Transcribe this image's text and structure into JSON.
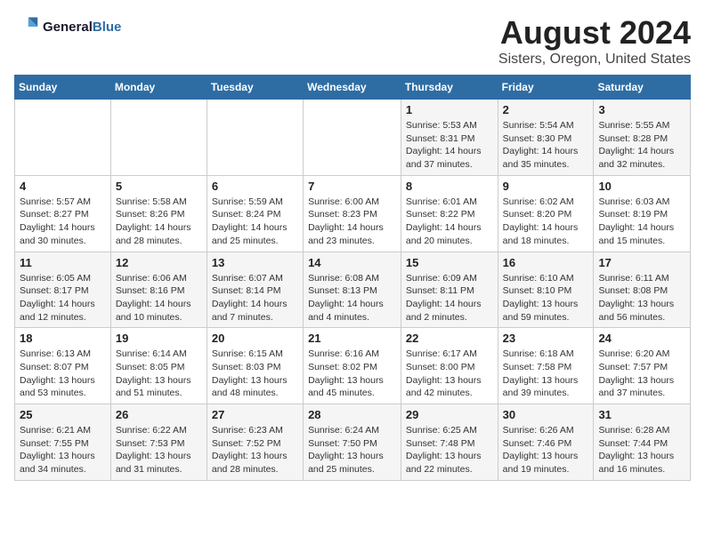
{
  "header": {
    "logo_line1": "General",
    "logo_line2": "Blue",
    "title": "August 2024",
    "subtitle": "Sisters, Oregon, United States"
  },
  "weekdays": [
    "Sunday",
    "Monday",
    "Tuesday",
    "Wednesday",
    "Thursday",
    "Friday",
    "Saturday"
  ],
  "weeks": [
    [
      {
        "day": "",
        "info": ""
      },
      {
        "day": "",
        "info": ""
      },
      {
        "day": "",
        "info": ""
      },
      {
        "day": "",
        "info": ""
      },
      {
        "day": "1",
        "info": "Sunrise: 5:53 AM\nSunset: 8:31 PM\nDaylight: 14 hours\nand 37 minutes."
      },
      {
        "day": "2",
        "info": "Sunrise: 5:54 AM\nSunset: 8:30 PM\nDaylight: 14 hours\nand 35 minutes."
      },
      {
        "day": "3",
        "info": "Sunrise: 5:55 AM\nSunset: 8:28 PM\nDaylight: 14 hours\nand 32 minutes."
      }
    ],
    [
      {
        "day": "4",
        "info": "Sunrise: 5:57 AM\nSunset: 8:27 PM\nDaylight: 14 hours\nand 30 minutes."
      },
      {
        "day": "5",
        "info": "Sunrise: 5:58 AM\nSunset: 8:26 PM\nDaylight: 14 hours\nand 28 minutes."
      },
      {
        "day": "6",
        "info": "Sunrise: 5:59 AM\nSunset: 8:24 PM\nDaylight: 14 hours\nand 25 minutes."
      },
      {
        "day": "7",
        "info": "Sunrise: 6:00 AM\nSunset: 8:23 PM\nDaylight: 14 hours\nand 23 minutes."
      },
      {
        "day": "8",
        "info": "Sunrise: 6:01 AM\nSunset: 8:22 PM\nDaylight: 14 hours\nand 20 minutes."
      },
      {
        "day": "9",
        "info": "Sunrise: 6:02 AM\nSunset: 8:20 PM\nDaylight: 14 hours\nand 18 minutes."
      },
      {
        "day": "10",
        "info": "Sunrise: 6:03 AM\nSunset: 8:19 PM\nDaylight: 14 hours\nand 15 minutes."
      }
    ],
    [
      {
        "day": "11",
        "info": "Sunrise: 6:05 AM\nSunset: 8:17 PM\nDaylight: 14 hours\nand 12 minutes."
      },
      {
        "day": "12",
        "info": "Sunrise: 6:06 AM\nSunset: 8:16 PM\nDaylight: 14 hours\nand 10 minutes."
      },
      {
        "day": "13",
        "info": "Sunrise: 6:07 AM\nSunset: 8:14 PM\nDaylight: 14 hours\nand 7 minutes."
      },
      {
        "day": "14",
        "info": "Sunrise: 6:08 AM\nSunset: 8:13 PM\nDaylight: 14 hours\nand 4 minutes."
      },
      {
        "day": "15",
        "info": "Sunrise: 6:09 AM\nSunset: 8:11 PM\nDaylight: 14 hours\nand 2 minutes."
      },
      {
        "day": "16",
        "info": "Sunrise: 6:10 AM\nSunset: 8:10 PM\nDaylight: 13 hours\nand 59 minutes."
      },
      {
        "day": "17",
        "info": "Sunrise: 6:11 AM\nSunset: 8:08 PM\nDaylight: 13 hours\nand 56 minutes."
      }
    ],
    [
      {
        "day": "18",
        "info": "Sunrise: 6:13 AM\nSunset: 8:07 PM\nDaylight: 13 hours\nand 53 minutes."
      },
      {
        "day": "19",
        "info": "Sunrise: 6:14 AM\nSunset: 8:05 PM\nDaylight: 13 hours\nand 51 minutes."
      },
      {
        "day": "20",
        "info": "Sunrise: 6:15 AM\nSunset: 8:03 PM\nDaylight: 13 hours\nand 48 minutes."
      },
      {
        "day": "21",
        "info": "Sunrise: 6:16 AM\nSunset: 8:02 PM\nDaylight: 13 hours\nand 45 minutes."
      },
      {
        "day": "22",
        "info": "Sunrise: 6:17 AM\nSunset: 8:00 PM\nDaylight: 13 hours\nand 42 minutes."
      },
      {
        "day": "23",
        "info": "Sunrise: 6:18 AM\nSunset: 7:58 PM\nDaylight: 13 hours\nand 39 minutes."
      },
      {
        "day": "24",
        "info": "Sunrise: 6:20 AM\nSunset: 7:57 PM\nDaylight: 13 hours\nand 37 minutes."
      }
    ],
    [
      {
        "day": "25",
        "info": "Sunrise: 6:21 AM\nSunset: 7:55 PM\nDaylight: 13 hours\nand 34 minutes."
      },
      {
        "day": "26",
        "info": "Sunrise: 6:22 AM\nSunset: 7:53 PM\nDaylight: 13 hours\nand 31 minutes."
      },
      {
        "day": "27",
        "info": "Sunrise: 6:23 AM\nSunset: 7:52 PM\nDaylight: 13 hours\nand 28 minutes."
      },
      {
        "day": "28",
        "info": "Sunrise: 6:24 AM\nSunset: 7:50 PM\nDaylight: 13 hours\nand 25 minutes."
      },
      {
        "day": "29",
        "info": "Sunrise: 6:25 AM\nSunset: 7:48 PM\nDaylight: 13 hours\nand 22 minutes."
      },
      {
        "day": "30",
        "info": "Sunrise: 6:26 AM\nSunset: 7:46 PM\nDaylight: 13 hours\nand 19 minutes."
      },
      {
        "day": "31",
        "info": "Sunrise: 6:28 AM\nSunset: 7:44 PM\nDaylight: 13 hours\nand 16 minutes."
      }
    ]
  ]
}
